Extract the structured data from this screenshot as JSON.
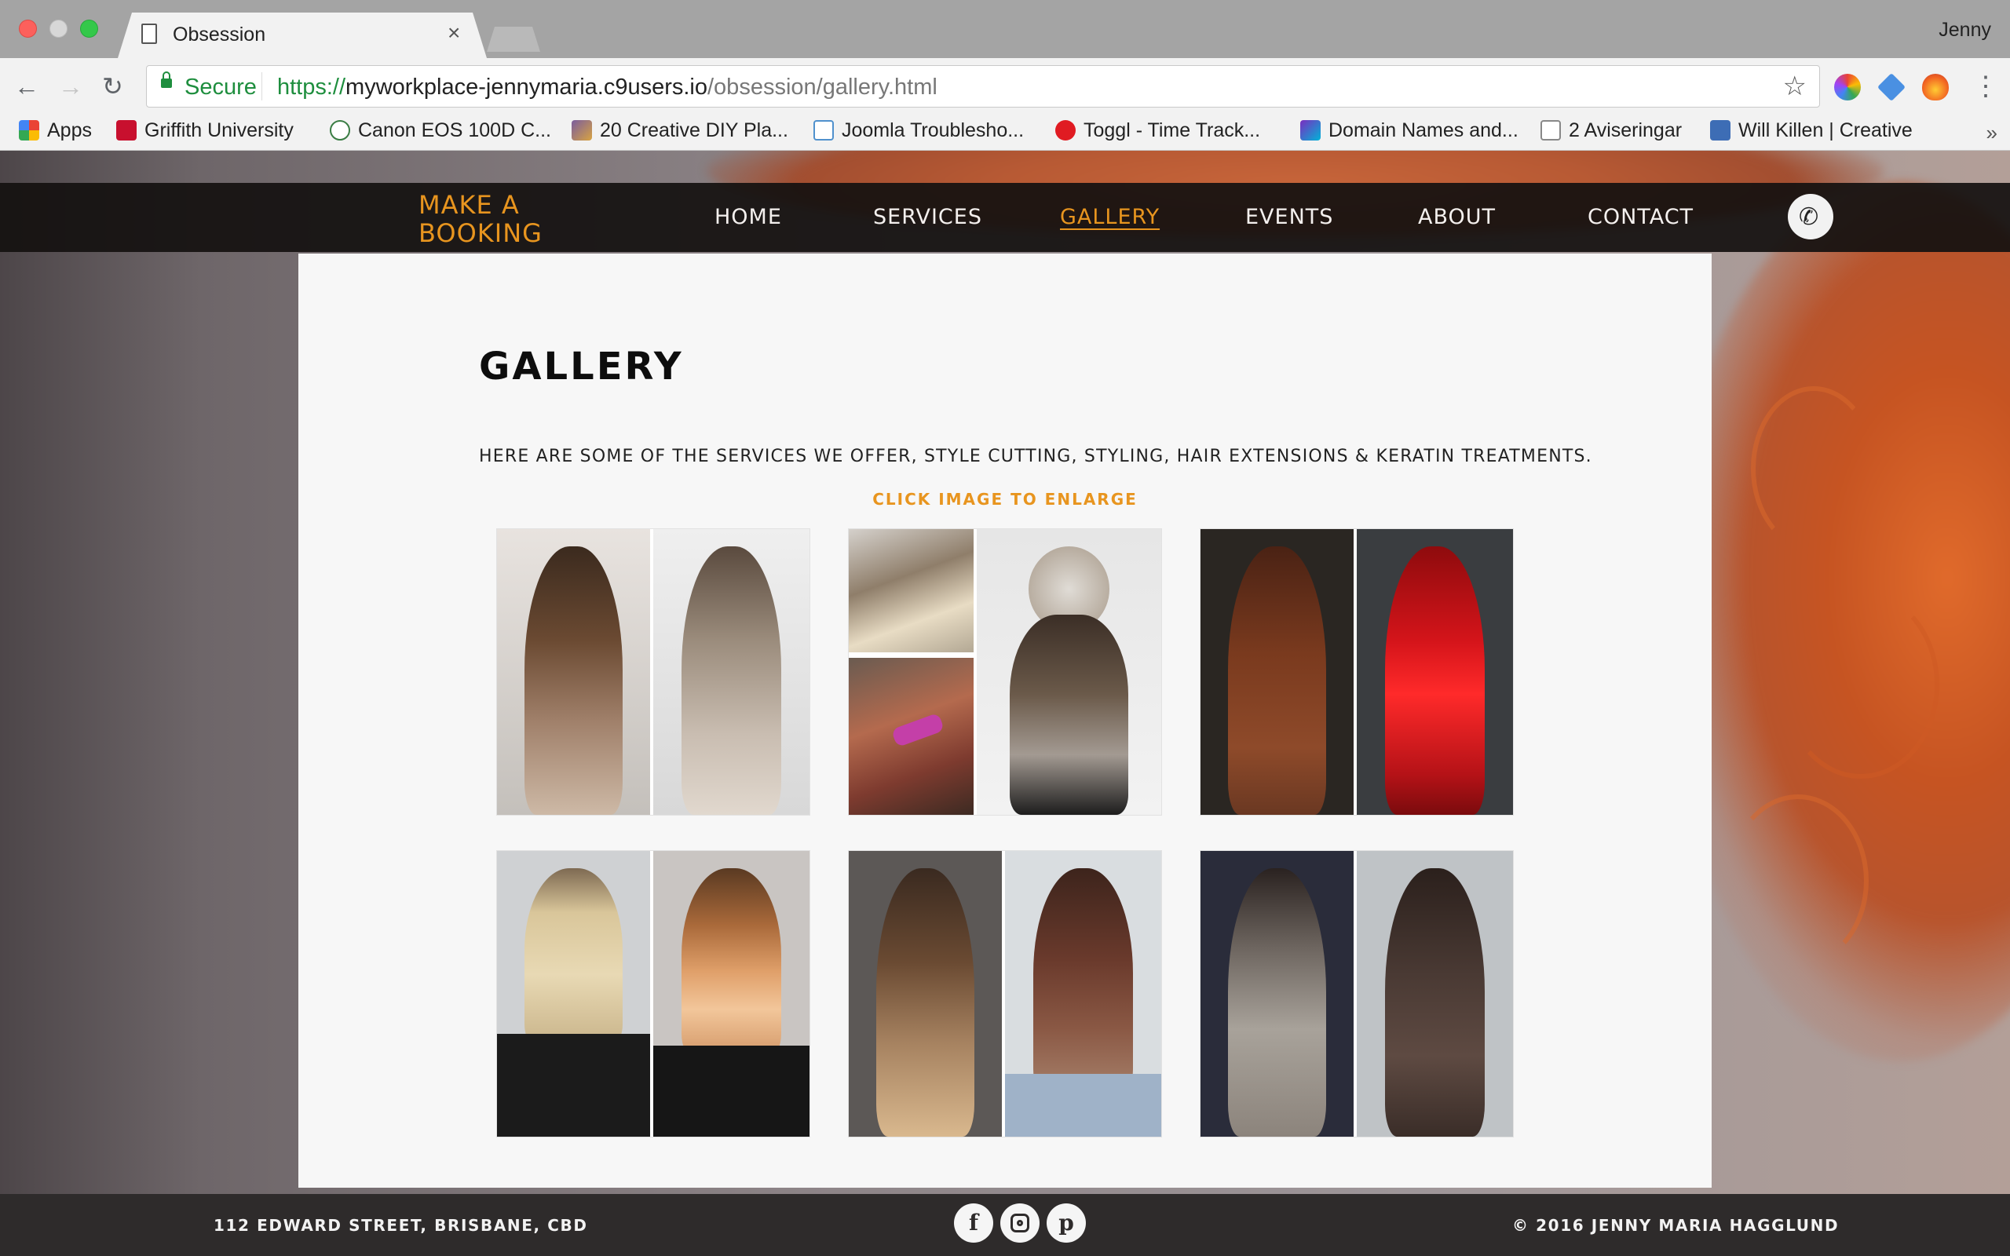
{
  "browser": {
    "tab_title": "Obsession",
    "tab_close": "×",
    "profile_name": "Jenny",
    "nav": {
      "back": "←",
      "forward": "→",
      "reload": "↻",
      "menu": "⋮",
      "star": "☆"
    },
    "address": {
      "security_label": "Secure",
      "url_scheme": "https://",
      "url_host": "myworkplace-jennymaria.c9users.io",
      "url_path": "/obsession/gallery.html"
    },
    "bookmarks": [
      {
        "label": "Apps",
        "icon": "apps-grid-icon",
        "color": "#e34133"
      },
      {
        "label": "Griffith University",
        "icon": "griffith-icon",
        "color": "#c8102e"
      },
      {
        "label": "Canon EOS 100D C...",
        "icon": "canon-icon",
        "color": "#3a7d44"
      },
      {
        "label": "20 Creative DIY Pla...",
        "icon": "diy-icon",
        "color": "#7a5c9e"
      },
      {
        "label": "Joomla Troublesho...",
        "icon": "joomla-icon",
        "color": "#5091cd"
      },
      {
        "label": "Toggl - Time Track...",
        "icon": "toggl-icon",
        "color": "#e01b22"
      },
      {
        "label": "Domain Names and...",
        "icon": "domain-icon",
        "color": "#7b2cbf"
      },
      {
        "label": "2 Aviseringar",
        "icon": "page-icon",
        "color": "#888888"
      },
      {
        "label": "Will Killen | Creative",
        "icon": "w-icon",
        "color": "#3d6db5"
      }
    ],
    "bookmarks_more": "»"
  },
  "site": {
    "booking_line1": "MAKE A",
    "booking_line2": "BOOKING",
    "nav": [
      {
        "label": "HOME",
        "active": false
      },
      {
        "label": "SERVICES",
        "active": false
      },
      {
        "label": "GALLERY",
        "active": true
      },
      {
        "label": "EVENTS",
        "active": false
      },
      {
        "label": "ABOUT",
        "active": false
      },
      {
        "label": "CONTACT",
        "active": false
      }
    ],
    "phone_icon": "✆",
    "accent_color": "#e8951f"
  },
  "gallery": {
    "title": "GALLERY",
    "intro": "HERE ARE SOME OF THE SERVICES WE OFFER, STYLE CUTTING, STYLING, HAIR EXTENSIONS & KERATIN TREATMENTS.",
    "cta": "CLICK IMAGE TO ENLARGE",
    "images": [
      {
        "name": "balayage-brunette-to-ash-blonde"
      },
      {
        "name": "undercut-bun-collage"
      },
      {
        "name": "brunette-to-red"
      },
      {
        "name": "blonde-to-copper-ombre-bob"
      },
      {
        "name": "brunette-ombre-to-chocolate"
      },
      {
        "name": "extensions-long-curls"
      }
    ]
  },
  "footer": {
    "address": "112 EDWARD STREET, BRISBANE, CBD",
    "copyright": "© 2016 JENNY MARIA HAGGLUND",
    "social": [
      {
        "name": "facebook-icon",
        "glyph": "f"
      },
      {
        "name": "instagram-icon",
        "glyph": ""
      },
      {
        "name": "pinterest-icon",
        "glyph": "p"
      }
    ]
  }
}
